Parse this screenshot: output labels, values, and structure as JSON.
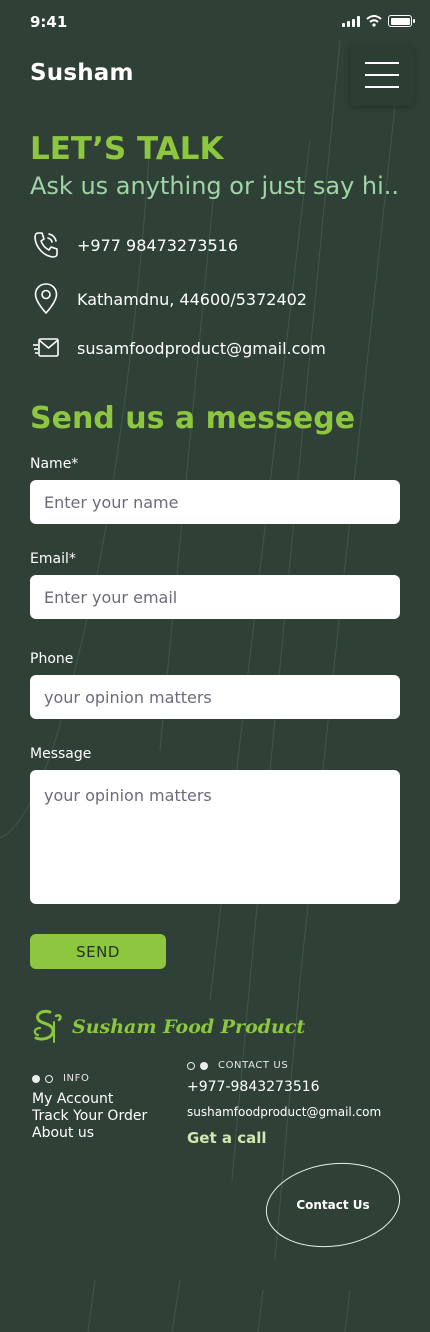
{
  "status_bar": {
    "time": "9:41"
  },
  "header": {
    "brand": "Susham",
    "menu_icon": "hamburger-menu-icon"
  },
  "hero": {
    "title": "LET’S TALK",
    "tagline": "Ask us anything or just say hi.."
  },
  "contact_info": [
    {
      "icon": "phone-icon",
      "text": "+977 98473273516"
    },
    {
      "icon": "location-pin-icon",
      "text": "Kathamdnu, 44600/5372402"
    },
    {
      "icon": "mail-icon",
      "text": "susamfoodproduct@gmail.com"
    }
  ],
  "form": {
    "title": "Send us a messege",
    "name_label": "Name*",
    "name_placeholder": "Enter your name",
    "email_label": "Email*",
    "email_placeholder": "Enter your email",
    "phone_label": "Phone",
    "phone_placeholder": "your opinion matters",
    "message_label": "Message",
    "message_placeholder": "your opinion matters",
    "send_label": "SEND"
  },
  "footer": {
    "logo_text": "Susham Food Product",
    "info_heading": "INFO",
    "info_links": [
      "My Account",
      "Track Your Order",
      "About us"
    ],
    "contact_heading": "CONTACT US",
    "phone": "+977-9843273516",
    "email": "sushamfoodproduct@gmail.com",
    "call_label": "Get a call",
    "contact_button": "Contact Us"
  },
  "colors": {
    "background": "#2f4136",
    "accent_green": "#8dc63f",
    "tagline_green": "#9fd4a6"
  }
}
